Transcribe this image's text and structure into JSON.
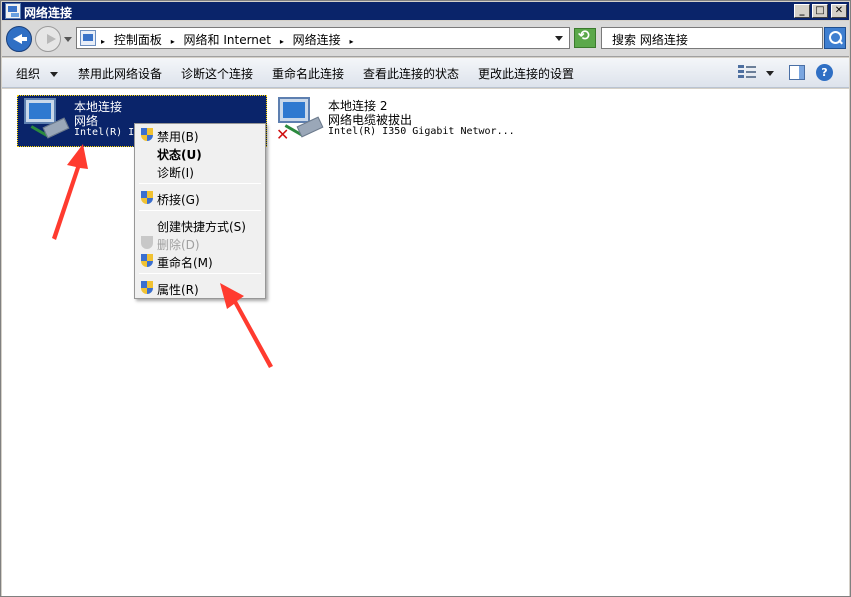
{
  "window": {
    "title": "网络连接",
    "controls": {
      "minimize": "_",
      "maximize": "□",
      "close": "✕"
    }
  },
  "address": {
    "crumbs": [
      "控制面板",
      "网络和 Internet",
      "网络连接"
    ],
    "search_placeholder": "搜索 网络连接"
  },
  "toolbar": {
    "organize": "组织",
    "disable": "禁用此网络设备",
    "diagnose": "诊断这个连接",
    "rename": "重命名此连接",
    "view_status": "查看此连接的状态",
    "change_settings": "更改此连接的设置"
  },
  "connections": [
    {
      "name": "本地连接",
      "status": "网络",
      "device": "Intel(R) I",
      "selected": true
    },
    {
      "name": "本地连接 2",
      "status": "网络电缆被拔出",
      "device": "Intel(R) I350 Gigabit Networ...",
      "selected": false
    }
  ],
  "context_menu": {
    "items": [
      {
        "label": "禁用(B)",
        "icon": "shield-icon"
      },
      {
        "label": "状态(U)",
        "bold": true
      },
      {
        "label": "诊断(I)"
      },
      {
        "label": "桥接(G)",
        "icon": "shield-icon"
      },
      {
        "label": "创建快捷方式(S)"
      },
      {
        "label": "删除(D)",
        "icon": "shield-icon",
        "disabled": true
      },
      {
        "label": "重命名(M)",
        "icon": "shield-icon"
      },
      {
        "label": "属性(R)",
        "icon": "shield-icon"
      }
    ]
  },
  "colors": {
    "selection": "#0a246a",
    "annotation_arrow": "#ff3b2f"
  }
}
